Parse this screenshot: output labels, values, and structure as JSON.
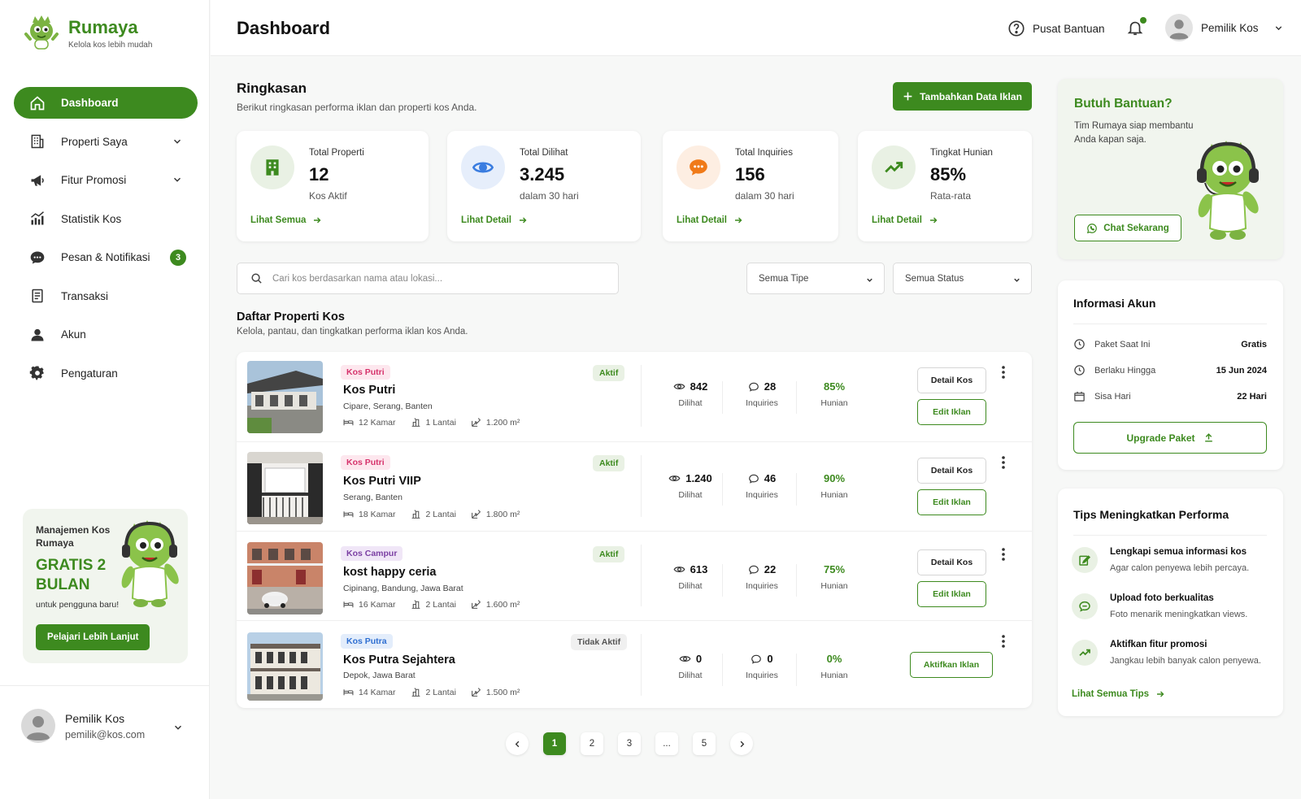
{
  "brand": {
    "name": "Rumaya",
    "tagline": "Kelola kos lebih mudah"
  },
  "colors": {
    "primary": "#3d8a1f",
    "accent_orange": "#f07a18",
    "accent_blue": "#3b7de0"
  },
  "sidebar": {
    "items": [
      {
        "label": "Dashboard",
        "icon": "home-icon",
        "active": true
      },
      {
        "label": "Properti Saya",
        "icon": "building-icon",
        "expandable": true
      },
      {
        "label": "Fitur Promosi",
        "icon": "megaphone-icon",
        "expandable": true
      },
      {
        "label": "Statistik Kos",
        "icon": "chart-icon"
      },
      {
        "label": "Pesan & Notifikasi",
        "icon": "chat-icon",
        "badge": "3"
      },
      {
        "label": "Transaksi",
        "icon": "receipt-icon"
      },
      {
        "label": "Akun",
        "icon": "user-icon"
      },
      {
        "label": "Pengaturan",
        "icon": "gear-icon"
      }
    ],
    "promo": {
      "line1": "Manajemen Kos Rumaya",
      "headline": "GRATIS 2 BULAN",
      "sub": "untuk pengguna baru!",
      "button": "Pelajari Lebih Lanjut"
    },
    "user": {
      "name": "Pemilik Kos",
      "email": "pemilik@kos.com"
    }
  },
  "header": {
    "title": "Dashboard",
    "help": "Pusat Bantuan",
    "user": "Pemilik Kos"
  },
  "summary": {
    "title": "Ringkasan",
    "subtitle": "Berikut ringkasan performa iklan dan properti kos Anda.",
    "add_button": "Tambahkan Data Iklan",
    "stats": [
      {
        "label": "Total Properti",
        "value": "12",
        "sub": "Kos Aktif",
        "link": "Lihat Semua",
        "icon": "building-icon"
      },
      {
        "label": "Total Dilihat",
        "value": "3.245",
        "sub": "dalam 30 hari",
        "link": "Lihat Detail",
        "icon": "eye-icon"
      },
      {
        "label": "Total Inquiries",
        "value": "156",
        "sub": "dalam 30 hari",
        "link": "Lihat Detail",
        "icon": "chat-bubble-icon"
      },
      {
        "label": "Tingkat Hunian",
        "value": "85%",
        "sub": "Rata-rata",
        "link": "Lihat Detail",
        "icon": "trend-up-icon"
      }
    ]
  },
  "filters": {
    "search_placeholder": "Cari kos berdasarkan nama atau lokasi...",
    "type": "Semua Tipe",
    "status": "Semua Status"
  },
  "list": {
    "title": "Daftar Properti Kos",
    "subtitle": "Kelola, pantau, dan tingkatkan performa iklan kos Anda.",
    "labels": {
      "views": "Dilihat",
      "inquiries": "Inquiries",
      "occupancy": "Hunian",
      "detail": "Detail Kos",
      "edit": "Edit Iklan",
      "activate": "Aktifkan Iklan"
    },
    "properties": [
      {
        "tag": "Kos Putri",
        "name": "Kos Putri",
        "location": "Cipare, Serang, Banten",
        "rooms": "12 Kamar",
        "floors": "1 Lantai",
        "area": "1.200 m²",
        "status": "Aktif",
        "views": "842",
        "inquiries": "28",
        "occupancy": "85%"
      },
      {
        "tag": "Kos Putri",
        "name": "Kos Putri VIIP",
        "location": "Serang, Banten",
        "rooms": "18 Kamar",
        "floors": "2 Lantai",
        "area": "1.800 m²",
        "status": "Aktif",
        "views": "1.240",
        "inquiries": "46",
        "occupancy": "90%"
      },
      {
        "tag": "Kos Campur",
        "name": "kost happy ceria",
        "location": "Cipinang, Bandung, Jawa Barat",
        "rooms": "16 Kamar",
        "floors": "2 Lantai",
        "area": "1.600 m²",
        "status": "Aktif",
        "views": "613",
        "inquiries": "22",
        "occupancy": "75%"
      },
      {
        "tag": "Kos Putra",
        "name": "Kos Putra Sejahtera",
        "location": "Depok, Jawa Barat",
        "rooms": "14 Kamar",
        "floors": "2 Lantai",
        "area": "1.500 m²",
        "status": "Tidak Aktif",
        "views": "0",
        "inquiries": "0",
        "occupancy": "0%"
      }
    ]
  },
  "pagination": {
    "pages": [
      "1",
      "2",
      "3",
      "...",
      "5"
    ],
    "current": "1"
  },
  "help_card": {
    "title": "Butuh Bantuan?",
    "text": "Tim Rumaya siap membantu Anda kapan saja.",
    "button": "Chat Sekarang"
  },
  "account": {
    "title": "Informasi Akun",
    "rows": [
      {
        "label": "Paket Saat Ini",
        "value": "Gratis"
      },
      {
        "label": "Berlaku Hingga",
        "value": "15 Jun 2024"
      },
      {
        "label": "Sisa Hari",
        "value": "22 Hari"
      }
    ],
    "button": "Upgrade Paket"
  },
  "tips": {
    "title": "Tips Meningkatkan Performa",
    "items": [
      {
        "title": "Lengkapi semua informasi kos",
        "desc": "Agar calon penyewa lebih percaya."
      },
      {
        "title": "Upload foto berkualitas",
        "desc": "Foto menarik meningkatkan views."
      },
      {
        "title": "Aktifkan fitur promosi",
        "desc": "Jangkau lebih banyak calon penyewa."
      }
    ],
    "link": "Lihat Semua Tips"
  }
}
